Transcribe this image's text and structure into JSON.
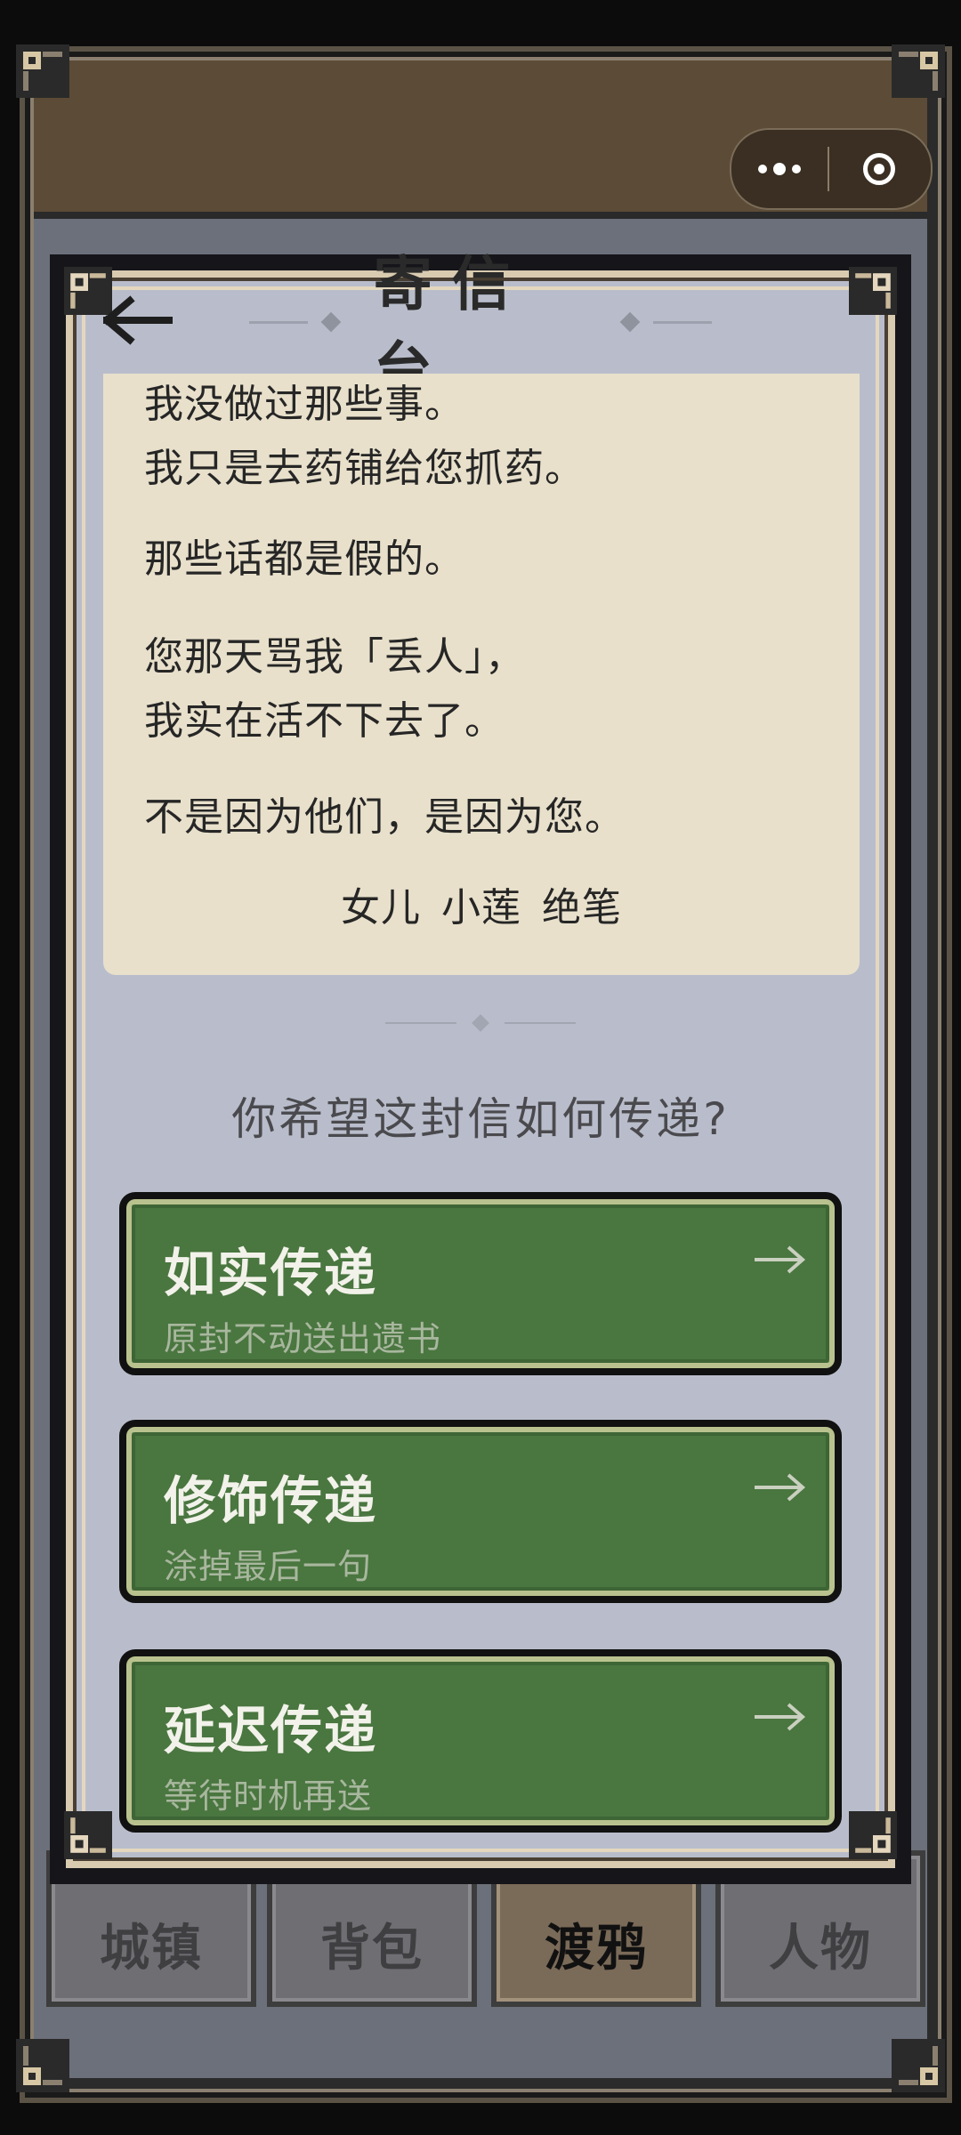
{
  "capsule": {
    "more_icon": "more-dots-icon",
    "close_icon": "target-close-icon"
  },
  "panel": {
    "title": "寄信台",
    "back_icon": "back-arrow-icon"
  },
  "letter": {
    "lines": [
      "我没做过那些事。",
      "我只是去药铺给您抓药。",
      "那些话都是假的。",
      "您那天骂我「丢人」，",
      "我实在活不下去了。",
      "不是因为他们，是因为您。"
    ],
    "signature": "女儿 小莲 绝笔"
  },
  "question": "你希望这封信如何传递?",
  "choices": [
    {
      "title": "如实传递",
      "subtitle": "原封不动送出遗书"
    },
    {
      "title": "修饰传递",
      "subtitle": "涂掉最后一句"
    },
    {
      "title": "延迟传递",
      "subtitle": "等待时机再送"
    }
  ],
  "tabs": [
    "城镇",
    "背包",
    "渡鸦",
    "人物"
  ],
  "active_tab": "渡鸦",
  "colors": {
    "panel_bg": "#b9bdcb",
    "letter_bg": "#e8e0cb",
    "button_green": "#4a7640",
    "top_bar": "#5c4b36"
  }
}
